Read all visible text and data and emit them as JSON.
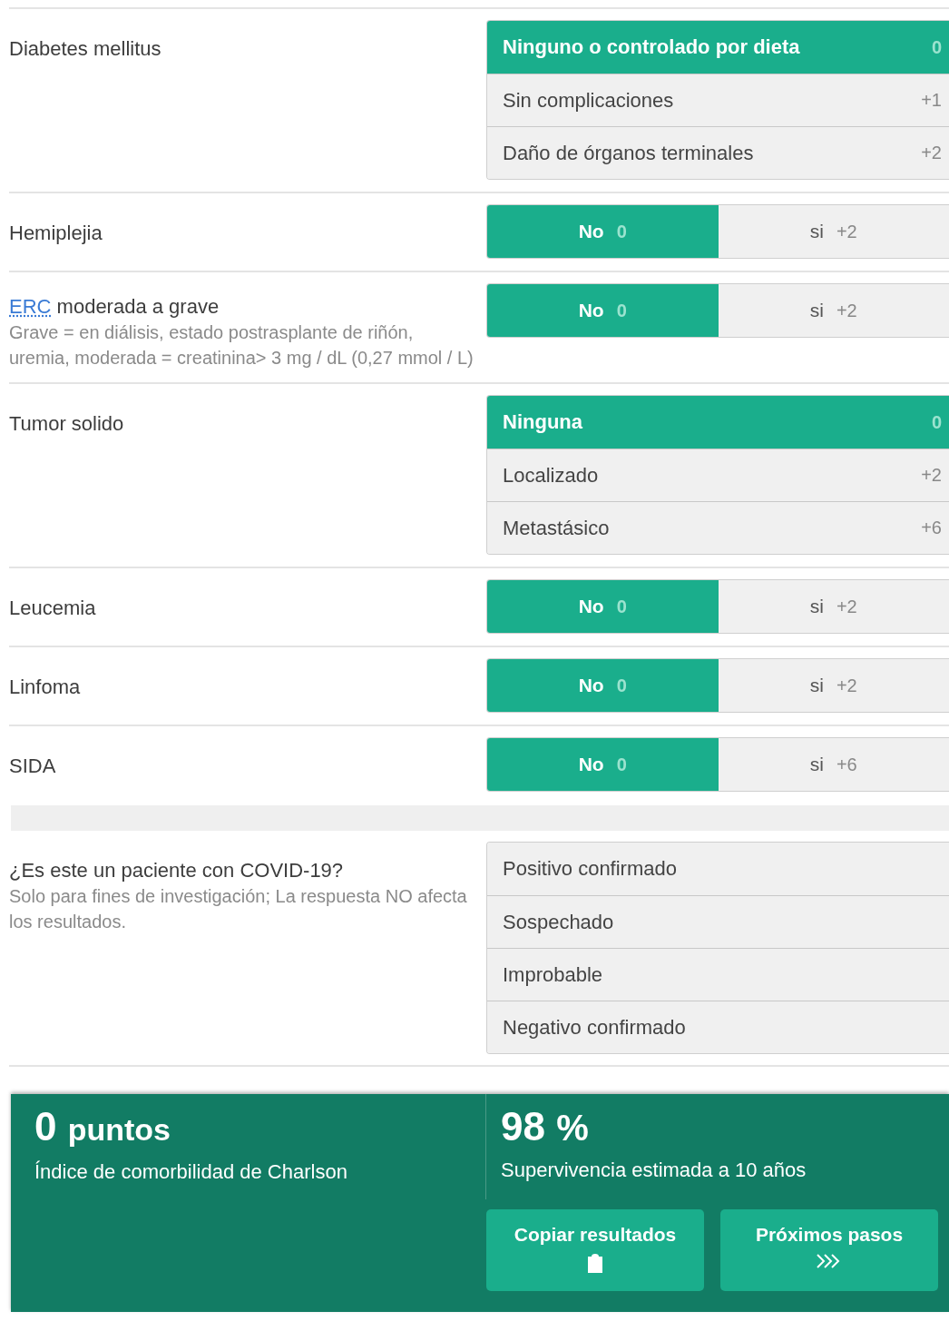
{
  "questions": [
    {
      "label": "Diabetes mellitus",
      "kind": "list",
      "options": [
        {
          "label": "Ninguno o controlado por dieta",
          "points": "0",
          "selected": true
        },
        {
          "label": "Sin complicaciones",
          "points": "+1",
          "selected": false
        },
        {
          "label": "Daño de órganos terminales",
          "points": "+2",
          "selected": false
        }
      ]
    },
    {
      "label": "Hemiplejia",
      "kind": "toggle",
      "options": [
        {
          "label": "No",
          "points": "0",
          "selected": true
        },
        {
          "label": "si",
          "points": "+2",
          "selected": false
        }
      ]
    },
    {
      "label_link": "ERC",
      "label": "moderada a grave",
      "hint": "Grave = en diálisis, estado postrasplante de riñón, uremia, moderada = creatinina> 3 mg / dL (0,27 mmol / L)",
      "kind": "toggle",
      "options": [
        {
          "label": "No",
          "points": "0",
          "selected": true
        },
        {
          "label": "si",
          "points": "+2",
          "selected": false
        }
      ]
    },
    {
      "label": "Tumor solido",
      "kind": "list",
      "options": [
        {
          "label": "Ninguna",
          "points": "0",
          "selected": true
        },
        {
          "label": "Localizado",
          "points": "+2",
          "selected": false
        },
        {
          "label": "Metastásico",
          "points": "+6",
          "selected": false
        }
      ]
    },
    {
      "label": "Leucemia",
      "kind": "toggle",
      "options": [
        {
          "label": "No",
          "points": "0",
          "selected": true
        },
        {
          "label": "si",
          "points": "+2",
          "selected": false
        }
      ]
    },
    {
      "label": "Linfoma",
      "kind": "toggle",
      "options": [
        {
          "label": "No",
          "points": "0",
          "selected": true
        },
        {
          "label": "si",
          "points": "+2",
          "selected": false
        }
      ]
    },
    {
      "label": "SIDA",
      "kind": "toggle",
      "options": [
        {
          "label": "No",
          "points": "0",
          "selected": true
        },
        {
          "label": "si",
          "points": "+6",
          "selected": false
        }
      ]
    }
  ],
  "covid": {
    "label": "¿Es este un paciente con COVID-19?",
    "hint": "Solo para fines de investigación; La respuesta NO afecta los resultados.",
    "options": [
      {
        "label": "Positivo confirmado",
        "selected": false
      },
      {
        "label": "Sospechado",
        "selected": false
      },
      {
        "label": "Improbable",
        "selected": false
      },
      {
        "label": "Negativo confirmado",
        "selected": false
      }
    ]
  },
  "result": {
    "score_value": "0",
    "score_unit": "puntos",
    "score_label": "Índice de comorbilidad de Charlson",
    "survival_value": "98",
    "survival_unit": "%",
    "survival_label": "Supervivencia estimada a 10 años",
    "buttons": [
      {
        "label": "Copiar resultados",
        "kind": "copy"
      },
      {
        "label": "Próximos pasos",
        "kind": "next"
      }
    ]
  }
}
